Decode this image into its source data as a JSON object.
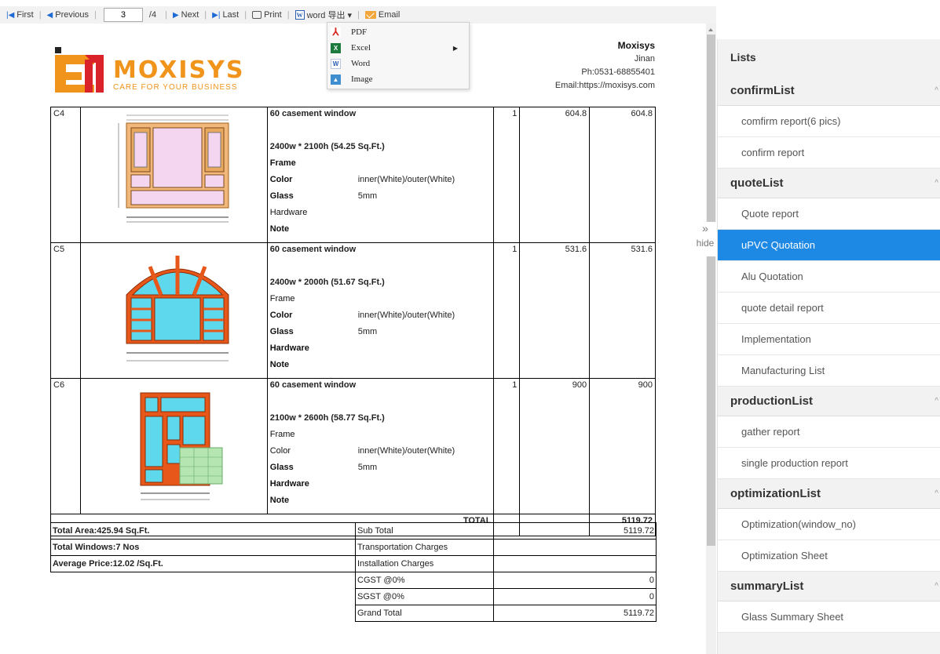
{
  "toolbar": {
    "first": "First",
    "previous": "Previous",
    "page_value": "3",
    "page_total": "/4",
    "next": "Next",
    "last": "Last",
    "print": "Print",
    "export": "word 导出",
    "email": "Email"
  },
  "export_menu": {
    "items": [
      {
        "label": "PDF",
        "icon": "pdf-icon"
      },
      {
        "label": "Excel",
        "icon": "excel-icon"
      },
      {
        "label": "Word",
        "icon": "word-icon"
      },
      {
        "label": "Image",
        "icon": "image-icon"
      }
    ]
  },
  "report": {
    "logo": {
      "text": "MOXISYS",
      "tagline": "CARE FOR YOUR BUSINESS"
    },
    "company": {
      "name": "Moxisys",
      "city": "Jinan",
      "phone": "Ph:0531-68855401",
      "email": "Email:https://moxisys.com"
    },
    "items": [
      {
        "code": "C4",
        "title": "60 casement window",
        "size": "2400w * 2100h (54.25 Sq.Ft.)",
        "frame": "Frame",
        "color_label": "Color",
        "color_value": "inner(White)/outer(White)",
        "glass_label": "Glass",
        "glass_value": "5mm",
        "hardware": "Hardware",
        "note": "Note",
        "qty": "1",
        "unit_price": "604.8",
        "amount": "604.8"
      },
      {
        "code": "C5",
        "title": "60 casement window",
        "size": "2400w * 2000h (51.67 Sq.Ft.)",
        "frame": "Frame",
        "color_label": "Color",
        "color_value": "inner(White)/outer(White)",
        "glass_label": "Glass",
        "glass_value": "5mm",
        "hardware": "Hardware",
        "note": "Note",
        "qty": "1",
        "unit_price": "531.6",
        "amount": "531.6"
      },
      {
        "code": "C6",
        "title": "60 casement window",
        "size": "2100w * 2600h (58.77 Sq.Ft.)",
        "frame": "Frame",
        "color_label": "Color",
        "color_value": "inner(White)/outer(White)",
        "glass_label": "Glass",
        "glass_value": "5mm",
        "hardware": "Hardware",
        "note": "Note",
        "qty": "1",
        "unit_price": "900",
        "amount": "900"
      }
    ],
    "total_label": "TOTAL",
    "total_value": "5119.72",
    "summary": {
      "total_area": "Total Area:425.94 Sq.Ft.",
      "total_windows": "Total Windows:7 Nos",
      "average_price": "Average Price:12.02 /Sq.Ft.",
      "rows": [
        {
          "label": "Sub Total",
          "value": "5119.72"
        },
        {
          "label": "Transportation Charges",
          "value": ""
        },
        {
          "label": "Installation Charges",
          "value": ""
        },
        {
          "label": "CGST @0%",
          "value": "0"
        },
        {
          "label": "SGST @0%",
          "value": "0"
        },
        {
          "label": "Grand Total",
          "value": "5119.72"
        }
      ]
    }
  },
  "hide_toggle": {
    "chevron": "»",
    "label": "hide"
  },
  "side_panel": {
    "title": "Lists",
    "accent": "#1e88e5",
    "groups": [
      {
        "name": "confirmList",
        "items": [
          "comfirm report(6 pics)",
          "confirm report"
        ]
      },
      {
        "name": "quoteList",
        "items": [
          "Quote report",
          "uPVC Quotation",
          "Alu Quotation",
          "quote detail report",
          "Implementation",
          "Manufacturing List"
        ]
      },
      {
        "name": "productionList",
        "items": [
          "gather report",
          "single production report"
        ]
      },
      {
        "name": "optimizationList",
        "items": [
          "Optimization(window_no)",
          "Optimization Sheet"
        ]
      },
      {
        "name": "summaryList",
        "items": [
          "Glass Summary Sheet"
        ]
      }
    ],
    "active_item": "uPVC Quotation"
  }
}
